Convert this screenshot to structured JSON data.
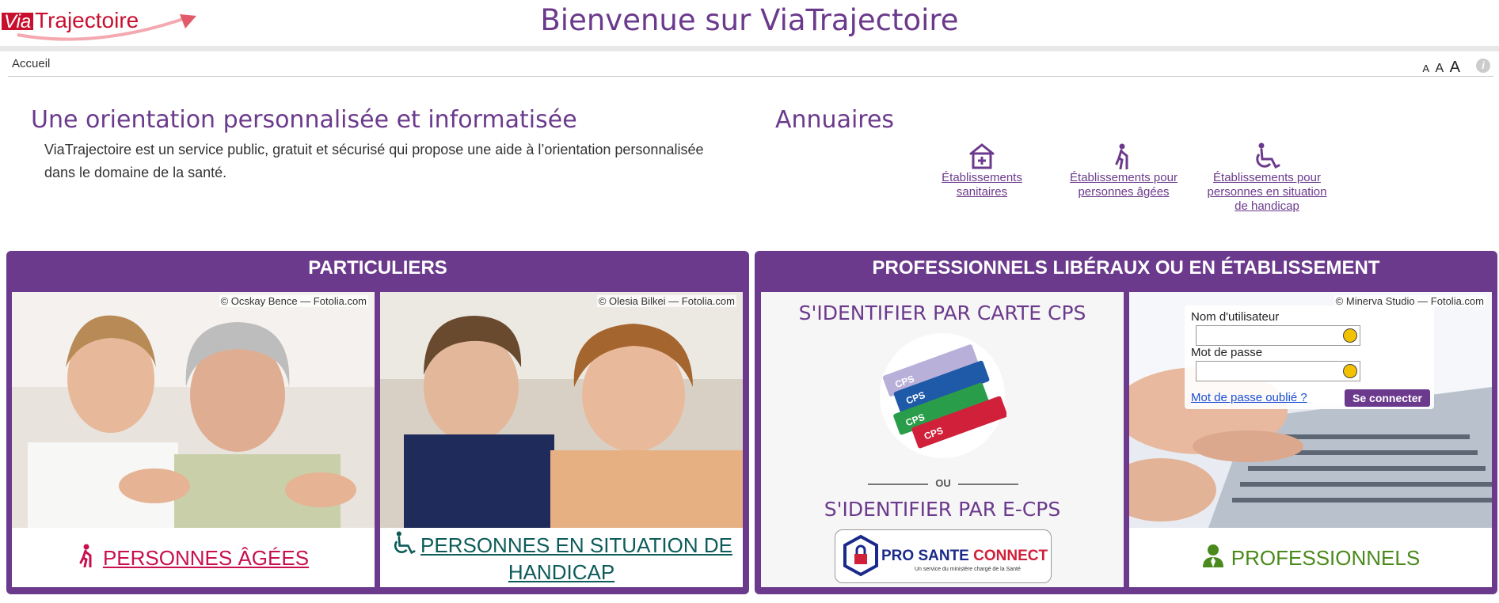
{
  "header": {
    "logo": "ViaTrajectoire",
    "title": "Bienvenue sur ViaTrajectoire"
  },
  "nav": {
    "breadcrumb": "Accueil",
    "font_small": "A",
    "font_medium": "A",
    "font_large": "A",
    "info": "i"
  },
  "intro": {
    "title": "Une orientation personnalisée et informatisée",
    "text": "ViaTrajectoire est un service public, gratuit et sécurisé qui propose une aide à l’orientation personnalisée dans le domaine de la santé."
  },
  "annuaires": {
    "title": "Annuaires",
    "items": [
      {
        "label": "Établissements sanitaires",
        "icon": "hospital-icon"
      },
      {
        "label": "Établissements pour personnes âgées",
        "icon": "elderly-person-icon"
      },
      {
        "label": "Établissements pour personnes en situation de handicap",
        "icon": "wheelchair-icon"
      }
    ]
  },
  "particuliers": {
    "title": "PARTICULIERS",
    "cards": [
      {
        "credit": "© Ocskay Bence — Fotolia.com",
        "link": "PERSONNES ÂGÉES",
        "color": "#c8104f"
      },
      {
        "credit": "© Olesia Bilkei — Fotolia.com",
        "link": "PERSONNES EN SITUATION DE HANDICAP",
        "color": "#0d5c5a"
      }
    ]
  },
  "pros": {
    "title": "PROFESSIONNELS LIBÉRAUX OU EN ÉTABLISSEMENT",
    "cps_title": "S'IDENTIFIER PAR CARTE CPS",
    "ou": "OU",
    "ecps_title": "S'IDENTIFIER PAR E-CPS",
    "psc_main": "PRO SANTE CONNECT",
    "psc_sub": "Un service du ministère chargé de la Santé",
    "credit": "© Minerva Studio — Fotolia.com",
    "username_label": "Nom d'utilisateur",
    "username_value": "",
    "password_label": "Mot de passe",
    "password_value": "",
    "forgot": "Mot de passe oublié ?",
    "login_button": "Se connecter",
    "link": "PROFESSIONNELS",
    "link_color": "#4a8a1c"
  },
  "colors": {
    "brand_purple": "#6b3a8c",
    "brand_red": "#c8102e"
  }
}
